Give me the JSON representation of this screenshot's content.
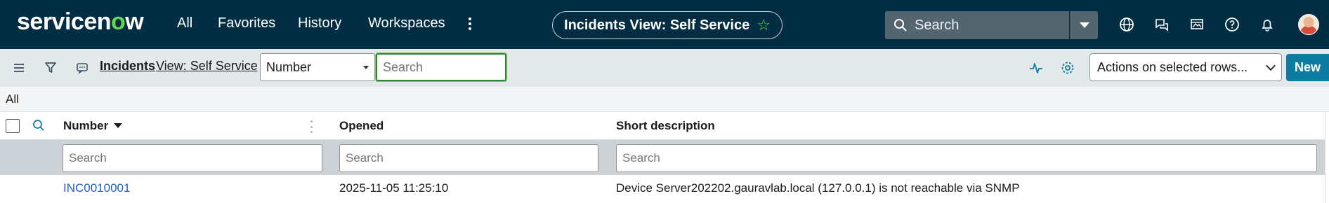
{
  "brand": {
    "logo_pre": "servicen",
    "logo_o": "o",
    "logo_post": "w",
    "accent": "#62d84e"
  },
  "nav": {
    "all": "All",
    "favorites": "Favorites",
    "history": "History",
    "workspaces": "Workspaces"
  },
  "title_pill": {
    "label": "Incidents View: Self Service"
  },
  "global_search": {
    "label": "Search"
  },
  "toolbar": {
    "breadcrumb_table": "Incidents",
    "breadcrumb_view": "View: Self Service",
    "field_select": "Number",
    "search_placeholder": "Search",
    "actions_select": "Actions on selected rows...",
    "new_label": "New"
  },
  "filter": {
    "label": "All"
  },
  "columns": {
    "number": "Number",
    "opened": "Opened",
    "short_description": "Short description"
  },
  "column_search": {
    "placeholder": "Search"
  },
  "rows": [
    {
      "number": "INC0010001",
      "opened": "2025-11-05 11:25:10",
      "short_description": "Device Server202202.gauravlab.local (127.0.0.1) is not reachable via SNMP"
    }
  ],
  "colors": {
    "topbar": "#032d42",
    "primary_button": "#0e7ca1",
    "link": "#1f5fbf",
    "focus": "#2e8540"
  }
}
